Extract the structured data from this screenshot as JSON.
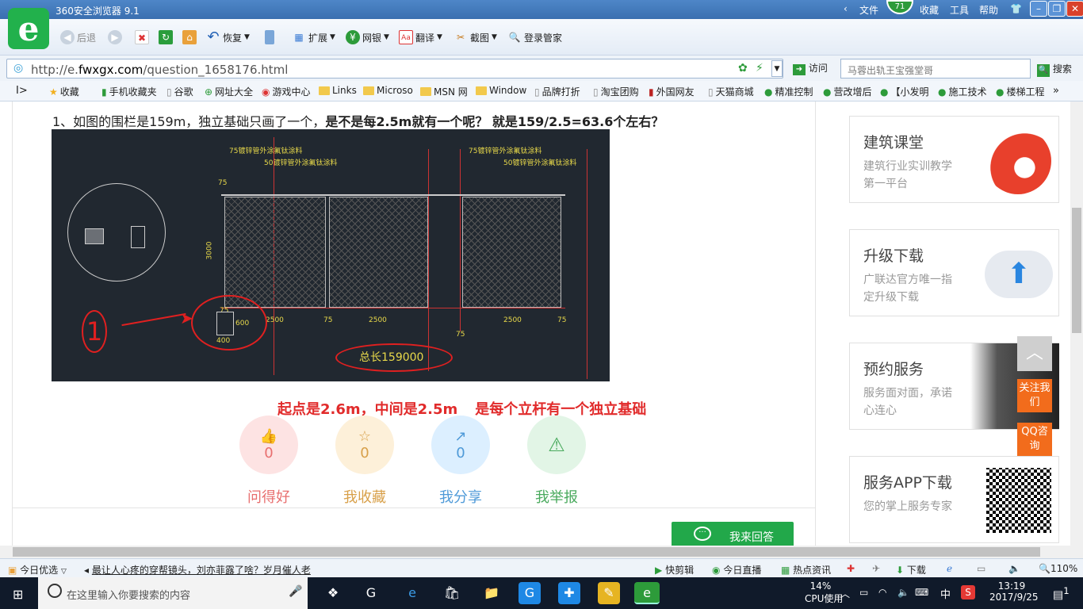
{
  "window": {
    "title": "360安全浏览器 9.1",
    "menus": [
      "文件",
      "收藏",
      "工具",
      "帮助"
    ],
    "badge": "71"
  },
  "toolbar": {
    "back": "后退",
    "restore": "恢复",
    "extend": "扩展",
    "bank": "网银",
    "translate": "翻译",
    "screenshot": "截图",
    "login": "登录管家"
  },
  "address": {
    "prefix": "http://e.",
    "domain": "fwxgx.com",
    "path": "/question_1658176.html",
    "visit": "访问",
    "search_placeholder": "马蓉出轨王宝强堂哥",
    "search_button": "搜索"
  },
  "bookmarks": [
    "收藏",
    "手机收藏夹",
    "谷歌",
    "网址大全",
    "游戏中心",
    "Links",
    "Microso",
    "MSN 网",
    "Window",
    "品牌打折",
    "淘宝团购",
    "外国网友",
    "天猫商城",
    "精准控制",
    "营改增后",
    "【小发明",
    "施工技术",
    "楼梯工程"
  ],
  "question": {
    "plain": "1、如图的围栏是159m，独立基础只画了一个，",
    "bold": "是不是每2.5m就有一个呢？ 就是159/2.5=63.6个左右？"
  },
  "drawing": {
    "label1": "75镀锌管外涂氟钛涂料",
    "label2": "50镀锌管外涂氟钛涂料",
    "label3": "75镀锌管外涂氟钛涂料",
    "label4": "50镀锌管外涂氟钛涂料",
    "dim_height": "3000",
    "dim_75a": "75",
    "dim_2500a": "2500",
    "dim_75b": "75",
    "dim_2500b": "2500",
    "dim_2500c": "2500",
    "dim_75c": "75",
    "dim_75d": "75",
    "dim_400": "400",
    "dim_600": "600",
    "dim_top75": "75",
    "total": "总长159000",
    "annotation_number": "1"
  },
  "caption": {
    "part1": "起点是2.6m，中间是2.5m",
    "part2": "是每个立杆有一个独立基础"
  },
  "actions": [
    {
      "label": "问得好",
      "count": "0",
      "icon": "thumbs-up-icon",
      "bg": "#fde3e3",
      "color": "#e86f6f"
    },
    {
      "label": "我收藏",
      "count": "0",
      "icon": "star-icon",
      "bg": "#fdf0d9",
      "color": "#d8a04a"
    },
    {
      "label": "我分享",
      "count": "0",
      "icon": "share-icon",
      "bg": "#dcefff",
      "color": "#4f9ad8"
    },
    {
      "label": "我举报",
      "count": "",
      "icon": "warning-icon",
      "bg": "#e2f5e6",
      "color": "#4aaa5e"
    }
  ],
  "answer_button": "我来回答",
  "sidebar": [
    {
      "title": "建筑课堂",
      "desc": "建筑行业实训教学第一平台"
    },
    {
      "title": "升级下载",
      "desc": "广联达官方唯一指定升级下载"
    },
    {
      "title": "预约服务",
      "desc": "服务面对面，承诺心连心"
    },
    {
      "title": "服务APP下载",
      "desc": "您的掌上服务专家"
    }
  ],
  "float": {
    "follow": "关注我们",
    "qq": "QQ咨询"
  },
  "statusbar": {
    "today": "今日优选",
    "news": "最让人心疼的穿帮镜头，刘亦菲露了啥？岁月催人老",
    "quick": "快剪辑",
    "live": "今日直播",
    "hot": "热点资讯",
    "download": "下载",
    "zoom": "110%"
  },
  "taskbar": {
    "search": "在这里输入你要搜索的内容",
    "cpu_value": "14%",
    "cpu_label": "CPU使用",
    "lang": "中",
    "time": "13:19",
    "date": "2017/9/25",
    "notifications": "1"
  }
}
